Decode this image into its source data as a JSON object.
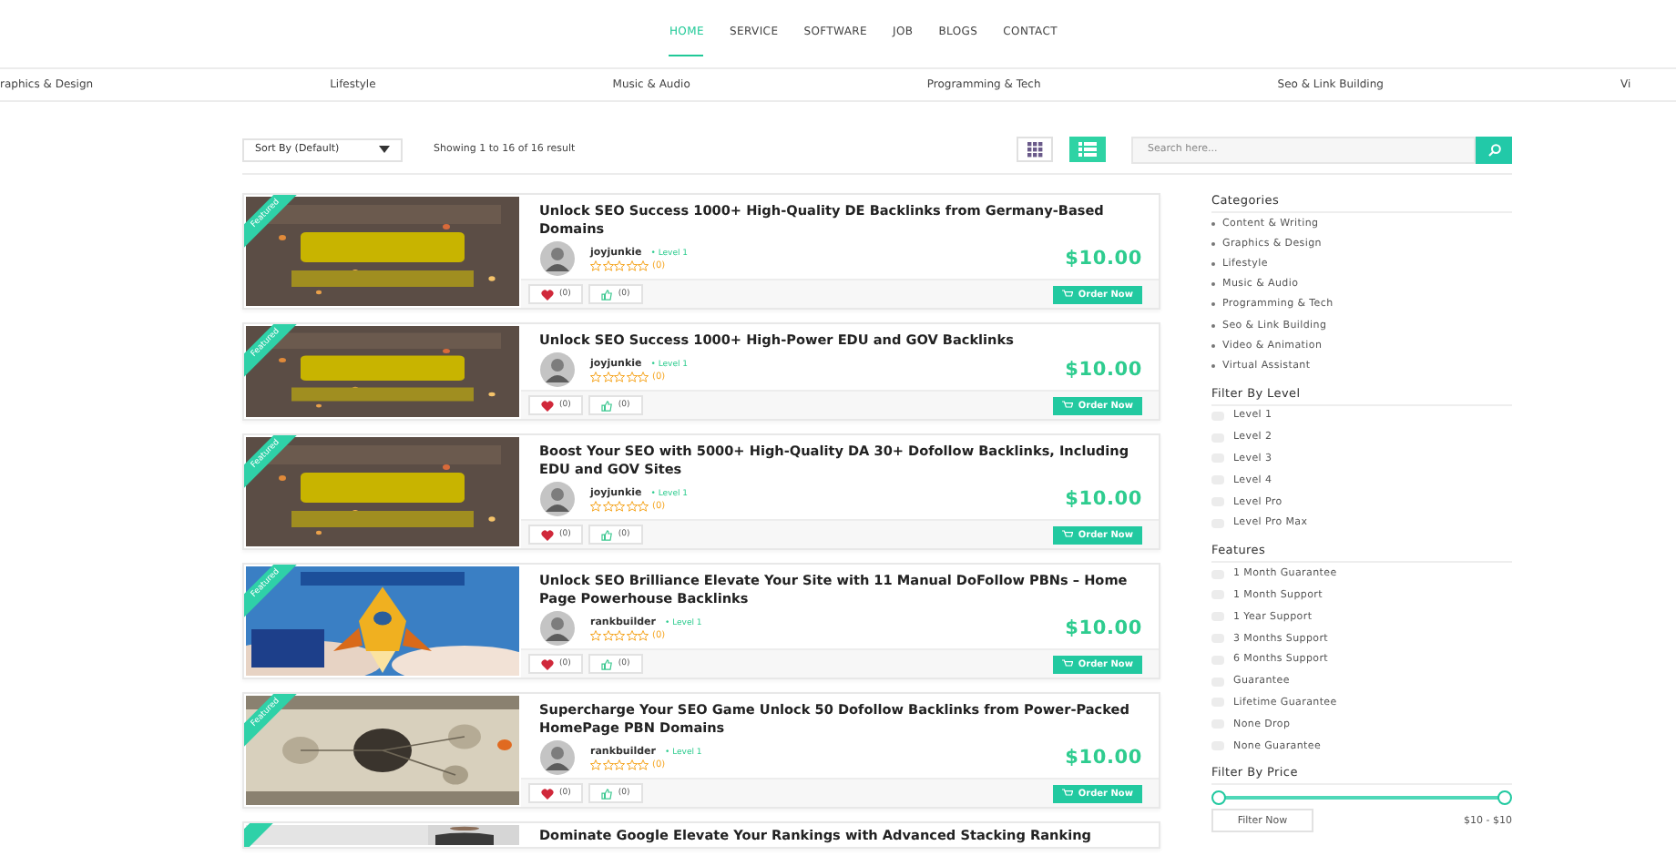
{
  "nav": [
    {
      "label": "HOME",
      "selected": true
    },
    {
      "label": "SERVICE",
      "selected": false
    },
    {
      "label": "SOFTWARE",
      "selected": false
    },
    {
      "label": "JOB",
      "selected": false
    },
    {
      "label": "BLOGS",
      "selected": false
    },
    {
      "label": "CONTACT",
      "selected": false
    }
  ],
  "category_bar": [
    "raphics & Design",
    "Lifestyle",
    "Music & Audio",
    "Programming & Tech",
    "Seo & Link Building",
    "Vi"
  ],
  "toolbar": {
    "sort": {
      "value": "Sort By (Default)"
    },
    "result_text": "Showing 1 to 16 of 16 result",
    "views": [
      {
        "kind": "grid",
        "selected": false
      },
      {
        "kind": "list",
        "selected": true
      }
    ],
    "search": {
      "placeholder": "Search here..."
    }
  },
  "listings": [
    {
      "badge": "Featured",
      "title": "Unlock SEO Success 1000+ High-Quality DE Backlinks from Germany-Based Domains",
      "seller": "joyjunkie",
      "level": "• Level 1",
      "stars": 0,
      "rating_count": "(0)",
      "price": "$10.00",
      "favorites": "(0)",
      "likes": "(0)",
      "order": "Order Now"
    },
    {
      "badge": "Featured",
      "title": "Unlock SEO Success 1000+ High-Power EDU and GOV Backlinks",
      "seller": "joyjunkie",
      "level": "• Level 1",
      "stars": 0,
      "rating_count": "(0)",
      "price": "$10.00",
      "favorites": "(0)",
      "likes": "(0)",
      "order": "Order Now"
    },
    {
      "badge": "Featured",
      "title": "Boost Your SEO with 5000+ High-Quality DA 30+ Dofollow Backlinks, Including EDU and GOV Sites",
      "seller": "joyjunkie",
      "level": "• Level 1",
      "stars": 0,
      "rating_count": "(0)",
      "price": "$10.00",
      "favorites": "(0)",
      "likes": "(0)",
      "order": "Order Now"
    },
    {
      "badge": "Featured",
      "title": "Unlock SEO Brilliance Elevate Your Site with 11 Manual DoFollow PBNs – Home Page Powerhouse Backlinks",
      "seller": "rankbuilder",
      "level": "• Level 1",
      "stars": 0,
      "rating_count": "(0)",
      "price": "$10.00",
      "favorites": "(0)",
      "likes": "(0)",
      "order": "Order Now"
    },
    {
      "badge": "Featured",
      "title": "Supercharge Your SEO Game Unlock 50 Dofollow Backlinks from Power-Packed HomePage PBN Domains",
      "seller": "rankbuilder",
      "level": "• Level 1",
      "stars": 0,
      "rating_count": "(0)",
      "price": "$10.00",
      "favorites": "(0)",
      "likes": "(0)",
      "order": "Order Now"
    },
    {
      "featured": true,
      "title": "Dominate Google Elevate Your Rankings with Advanced Stacking Ranking"
    }
  ],
  "sidebar": {
    "categories": {
      "heading": "Categories",
      "items": [
        "Content & Writing",
        "Graphics & Design",
        "Lifestyle",
        "Music & Audio",
        "Programming & Tech",
        "Seo & Link Building",
        "Video & Animation",
        "Virtual Assistant"
      ]
    },
    "level_filter": {
      "heading": "Filter By Level",
      "items": [
        {
          "label": "Level 1",
          "checked": false
        },
        {
          "label": "Level 2",
          "checked": false
        },
        {
          "label": "Level 3",
          "checked": false
        },
        {
          "label": "Level 4",
          "checked": false
        },
        {
          "label": "Level Pro",
          "checked": false
        },
        {
          "label": "Level Pro Max",
          "checked": false
        }
      ]
    },
    "features": {
      "heading": "Features",
      "items": [
        {
          "label": "1 Month Guarantee",
          "checked": false
        },
        {
          "label": "1 Month Support",
          "checked": false
        },
        {
          "label": "1 Year Support",
          "checked": false
        },
        {
          "label": "3 Months Support",
          "checked": false
        },
        {
          "label": "6 Months Support",
          "checked": false
        },
        {
          "label": "Guarantee",
          "checked": false
        },
        {
          "label": "Lifetime Guarantee",
          "checked": false
        },
        {
          "label": "None Drop",
          "checked": false
        },
        {
          "label": "None Guarantee",
          "checked": false
        }
      ]
    },
    "price_filter": {
      "heading": "Filter By Price",
      "level": 1,
      "button": "Filter Now",
      "range": "$10 - $10"
    }
  }
}
